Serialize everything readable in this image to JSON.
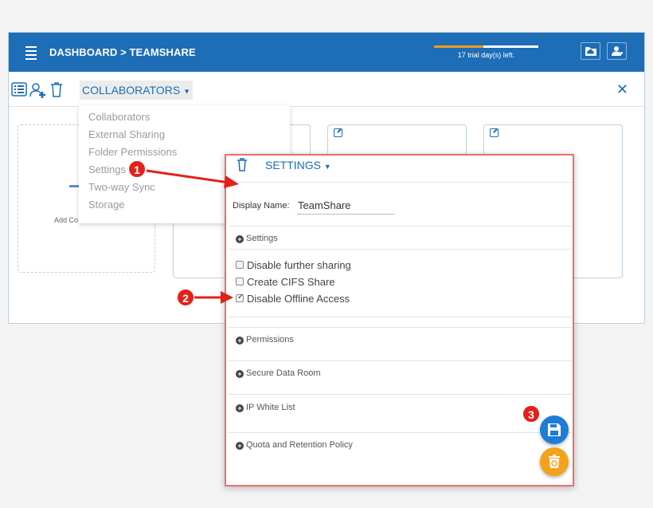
{
  "header": {
    "breadcrumb": "DASHBOARD > TEAMSHARE",
    "trial_text": "17 trial day(s) left.",
    "trial_progress": 0.47,
    "icons": [
      "folder-cloud-icon",
      "user-settings-icon"
    ]
  },
  "toolbar": {
    "collaborators_label": "COLLABORATORS",
    "icons": [
      "list-icon",
      "add-user-icon",
      "trash-icon",
      "close-icon"
    ]
  },
  "cards": {
    "add_card_text": "Add Co"
  },
  "dropdown": {
    "items": [
      "Collaborators",
      "External Sharing",
      "Folder Permissions",
      "Settings",
      "Two-way Sync",
      "Storage"
    ]
  },
  "settings_panel": {
    "title": "SETTINGS",
    "display_name_label": "Display Name:",
    "display_name_value": "TeamShare",
    "settings_section": "Settings",
    "checkboxes": [
      {
        "label": "Disable further sharing",
        "checked": false
      },
      {
        "label": "Create CIFS Share",
        "checked": false
      },
      {
        "label": "Disable Offline Access",
        "checked": true
      }
    ],
    "sections": [
      "Permissions",
      "Secure Data Room",
      "IP White List",
      "Quota and Retention Policy"
    ]
  },
  "fabs": [
    "save-icon",
    "recycle-trash-icon"
  ],
  "annotations": [
    "1",
    "2",
    "3"
  ],
  "colors": {
    "primary": "#1d6db7",
    "accent_orange": "#f39a22",
    "annotation_red": "#e32119",
    "panel_border": "#ee6e6e"
  }
}
